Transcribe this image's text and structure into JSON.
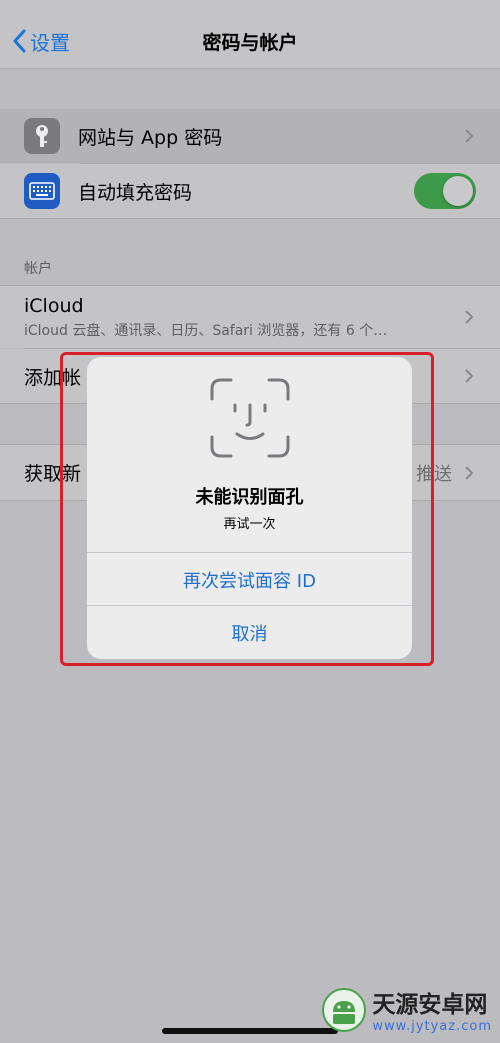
{
  "nav": {
    "back_label": "设置",
    "title": "密码与帐户"
  },
  "passwords": {
    "website_label": "网站与 App 密码",
    "autofill_label": "自动填充密码",
    "autofill_on": true
  },
  "accounts": {
    "header": "帐户",
    "icloud_title": "iCloud",
    "icloud_detail": "iCloud 云盘、通讯录、日历、Safari 浏览器，还有 6 个…",
    "add_label_visible": "添加帐",
    "fetch_label_visible": "获取新",
    "fetch_value_visible": "推送"
  },
  "dialog": {
    "title": "未能识别面孔",
    "subtitle": "再试一次",
    "retry_label": "再次尝试面容 ID",
    "cancel_label": "取消"
  },
  "watermark": {
    "name": "天源安卓网",
    "url": "www.jytyaz.com"
  },
  "colors": {
    "accent": "#1d73d6",
    "toggle_on": "#3c9a48",
    "highlight": "#d8202c"
  }
}
